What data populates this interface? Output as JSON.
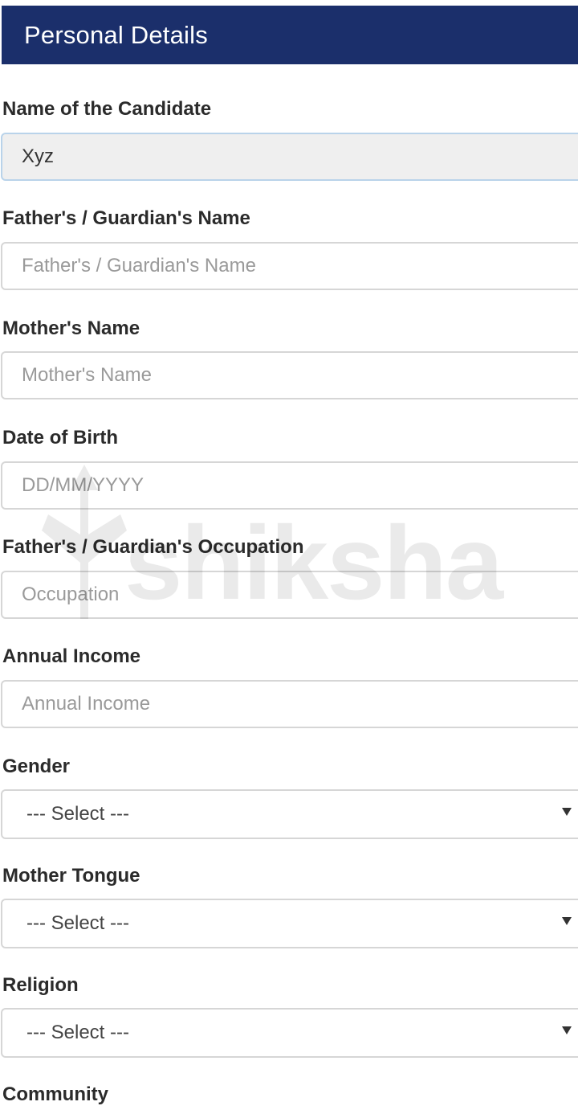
{
  "header": {
    "title": "Personal Details"
  },
  "fields": {
    "candidate_name": {
      "label": "Name of the Candidate",
      "value": "Xyz",
      "placeholder": ""
    },
    "father_name": {
      "label": "Father's / Guardian's Name",
      "value": "",
      "placeholder": "Father's / Guardian's Name"
    },
    "mother_name": {
      "label": "Mother's Name",
      "value": "",
      "placeholder": "Mother's Name"
    },
    "dob": {
      "label": "Date of Birth",
      "value": "",
      "placeholder": "DD/MM/YYYY"
    },
    "occupation": {
      "label": "Father's / Guardian's Occupation",
      "value": "",
      "placeholder": "Occupation"
    },
    "income": {
      "label": "Annual Income",
      "value": "",
      "placeholder": "Annual Income"
    },
    "gender": {
      "label": "Gender",
      "selected": "--- Select ---"
    },
    "mother_tongue": {
      "label": "Mother Tongue",
      "selected": "--- Select ---"
    },
    "religion": {
      "label": "Religion",
      "selected": "--- Select ---"
    },
    "community": {
      "label": "Community"
    }
  },
  "watermark": {
    "text": "shiksha",
    "icon": "shiksha-logo-icon"
  },
  "colors": {
    "header_bg": "#1b2f6b",
    "header_text": "#ffffff",
    "filled_input_bg": "#efefef",
    "filled_input_border": "#b9d3ea",
    "input_border": "#d6d6d6",
    "placeholder": "#9a9a9a"
  }
}
